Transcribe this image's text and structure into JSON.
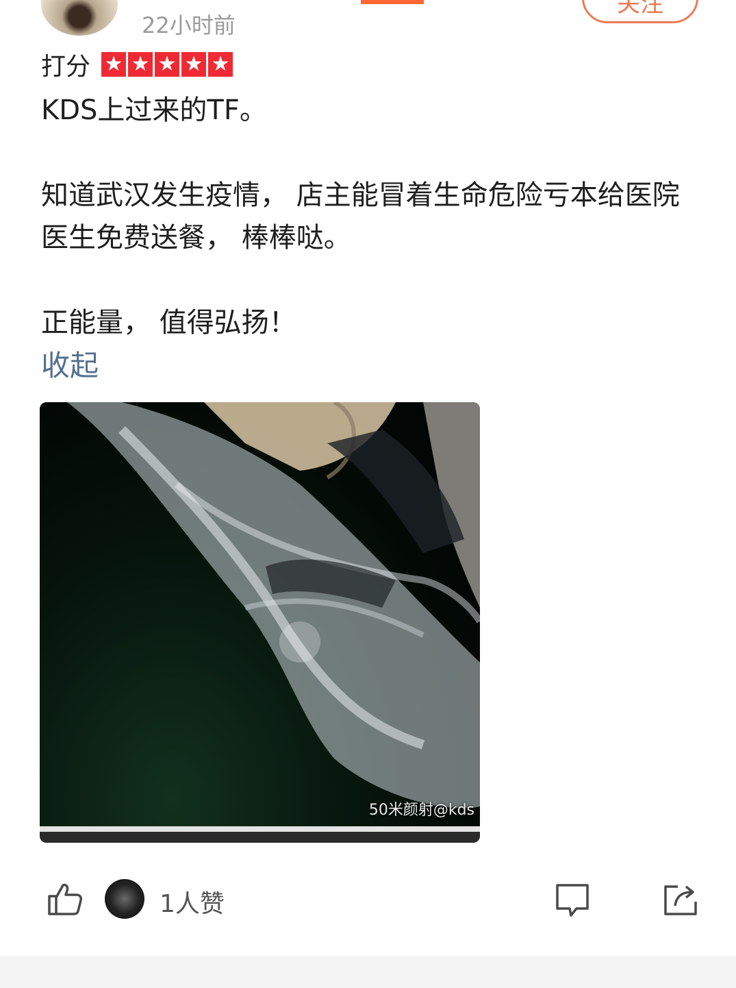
{
  "header": {
    "time": "22小时前",
    "follow_label": "关注"
  },
  "rating": {
    "label": "打分",
    "stars": 5,
    "max": 5,
    "color": "#ef2a34"
  },
  "review": {
    "line1": "KDS上过来的TF。",
    "line2": "知道武汉发生疫情， 店主能冒着生命危险亏本给医院医生免费送餐， 棒棒哒。",
    "line3": "正能量， 值得弘扬！",
    "collapse_label": "收起"
  },
  "photo": {
    "watermark": "50米颜射@kds"
  },
  "actions": {
    "likes_text": "1人赞"
  },
  "colors": {
    "accent": "#ff6633",
    "link": "#53708e",
    "follow": "#ee7a55"
  }
}
